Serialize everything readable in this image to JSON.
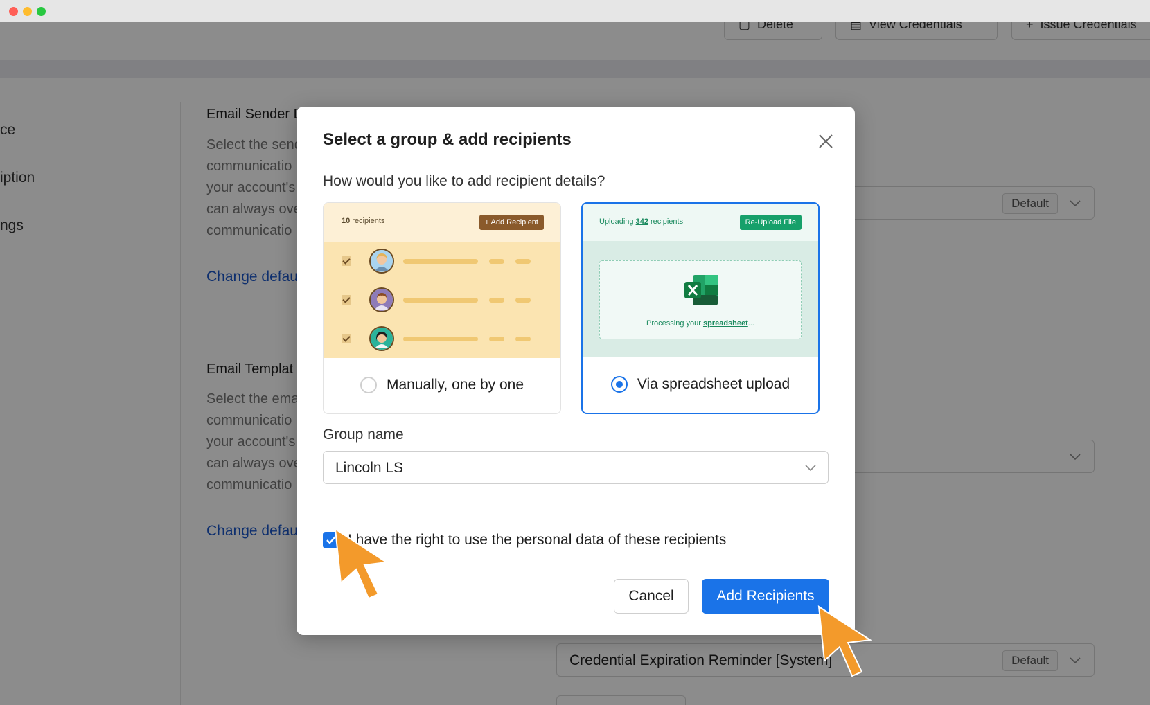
{
  "window": {
    "controls": [
      "close",
      "minimize",
      "maximize"
    ]
  },
  "toolbar": {
    "buttons": [
      "Delete",
      "View Credentials",
      "Issue Credentials"
    ]
  },
  "sidebar": {
    "items": [
      "ce",
      "iption",
      "ngs"
    ]
  },
  "sections": [
    {
      "title": "Email Sender D",
      "desc": [
        "Select the send",
        "communicatio",
        "your account's",
        "can always ove",
        "communicatio"
      ],
      "link": "Change defaul",
      "select_badge": "Default"
    },
    {
      "title": "Email Templat",
      "desc": [
        "Select the ema",
        "communicatio",
        "your account's",
        "can always ove",
        "communicatio"
      ],
      "link": "Change defaul"
    }
  ],
  "bottom_select": {
    "value": "Credential Expiration Reminder [System]",
    "badge": "Default"
  },
  "modal": {
    "title": "Select a group & add recipients",
    "question": "How would you like to add recipient details?",
    "options": {
      "manual": {
        "label": "Manually, one by one",
        "selected": false,
        "preview": {
          "count": "10",
          "count_suffix": " recipients",
          "add_button": "+ Add Recipient"
        }
      },
      "spreadsheet": {
        "label": "Via spreadsheet upload",
        "selected": true,
        "preview": {
          "uploading_prefix": "Uploading ",
          "count": "342",
          "count_suffix": " recipients",
          "reupload_button": "Re-Upload File",
          "processing_prefix": "Processing your ",
          "processing_word": "spreadsheet",
          "processing_suffix": "..."
        }
      }
    },
    "group_label": "Group name",
    "group_value": "Lincoln LS",
    "consent_text": "I have the right to use the personal data of these recipients",
    "consent_checked": true,
    "cancel_label": "Cancel",
    "add_label": "Add Recipients"
  },
  "colors": {
    "accent": "#1a73e8",
    "cursor": "#f39a2b",
    "link": "#1a56c9"
  }
}
